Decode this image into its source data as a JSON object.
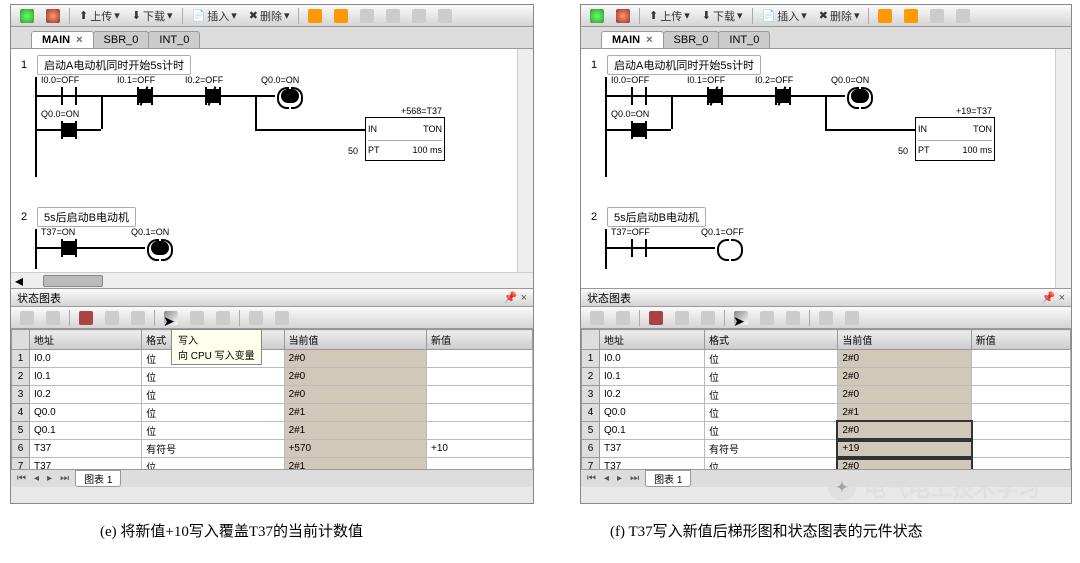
{
  "toolbar": {
    "upload": "上传",
    "download": "下载",
    "insert": "插入",
    "delete": "删除"
  },
  "tabs": {
    "main": "MAIN",
    "sbr": "SBR_0",
    "int": "INT_0"
  },
  "left": {
    "rung1_comment": "启动A电动机同时开始5s计时",
    "rung2_comment": "5s后启动B电动机",
    "contacts": {
      "i00": "I0.0=OFF",
      "i01": "I0.1=OFF",
      "i02": "I0.2=OFF",
      "q00coil": "Q0.0=ON",
      "q00": "Q0.0=ON",
      "t37": "T37=ON",
      "q01coil": "Q0.1=ON"
    },
    "timer": {
      "title": "+568=T37",
      "in": "IN",
      "ton": "TON",
      "pt": "PT",
      "ptval": "50",
      "time": "100 ms"
    },
    "tooltip_line1": "写入",
    "tooltip_line2": "向 CPU 写入变量"
  },
  "right": {
    "rung1_comment": "启动A电动机同时开始5s计时",
    "rung2_comment": "5s后启动B电动机",
    "contacts": {
      "i00": "I0.0=OFF",
      "i01": "I0.1=OFF",
      "i02": "I0.2=OFF",
      "q00coil": "Q0.0=ON",
      "q00": "Q0.0=ON",
      "t37": "T37=OFF",
      "q01coil": "Q0.1=OFF"
    },
    "timer": {
      "title": "+19=T37",
      "in": "IN",
      "ton": "TON",
      "pt": "PT",
      "ptval": "50",
      "time": "100 ms"
    }
  },
  "status": {
    "title": "状态图表",
    "headers": {
      "addr": "地址",
      "fmt": "格式",
      "cur": "当前值",
      "new": "新值"
    },
    "footer_tab": "图表 1"
  },
  "table_left": [
    {
      "addr": "I0.0",
      "fmt": "位",
      "cur": "2#0",
      "new": ""
    },
    {
      "addr": "I0.1",
      "fmt": "位",
      "cur": "2#0",
      "new": ""
    },
    {
      "addr": "I0.2",
      "fmt": "位",
      "cur": "2#0",
      "new": ""
    },
    {
      "addr": "Q0.0",
      "fmt": "位",
      "cur": "2#1",
      "new": ""
    },
    {
      "addr": "Q0.1",
      "fmt": "位",
      "cur": "2#1",
      "new": ""
    },
    {
      "addr": "T37",
      "fmt": "有符号",
      "cur": "+570",
      "new": "+10"
    },
    {
      "addr": "T37",
      "fmt": "位",
      "cur": "2#1",
      "new": ""
    }
  ],
  "table_right": [
    {
      "addr": "I0.0",
      "fmt": "位",
      "cur": "2#0",
      "new": ""
    },
    {
      "addr": "I0.1",
      "fmt": "位",
      "cur": "2#0",
      "new": ""
    },
    {
      "addr": "I0.2",
      "fmt": "位",
      "cur": "2#0",
      "new": ""
    },
    {
      "addr": "Q0.0",
      "fmt": "位",
      "cur": "2#1",
      "new": ""
    },
    {
      "addr": "Q0.1",
      "fmt": "位",
      "cur": "2#0",
      "new": ""
    },
    {
      "addr": "T37",
      "fmt": "有符号",
      "cur": "+19",
      "new": ""
    },
    {
      "addr": "T37",
      "fmt": "位",
      "cur": "2#0",
      "new": ""
    }
  ],
  "captions": {
    "left": "(e)  将新值+10写入覆盖T37的当前计数值",
    "right": "(f)  T37写入新值后梯形图和状态图表的元件状态"
  },
  "watermark": "电气电工技术学习"
}
